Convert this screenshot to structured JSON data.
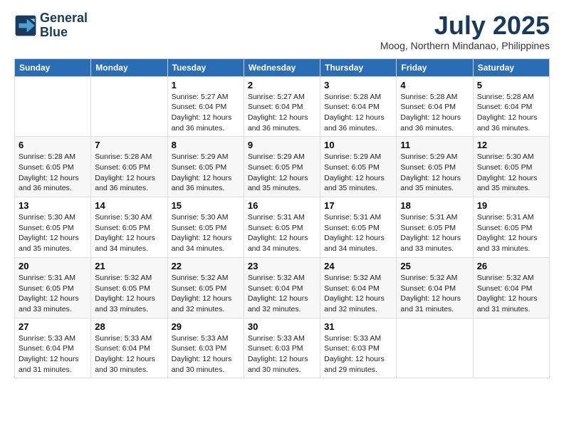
{
  "logo": {
    "line1": "General",
    "line2": "Blue"
  },
  "title": "July 2025",
  "location": "Moog, Northern Mindanao, Philippines",
  "days_of_week": [
    "Sunday",
    "Monday",
    "Tuesday",
    "Wednesday",
    "Thursday",
    "Friday",
    "Saturday"
  ],
  "weeks": [
    [
      {
        "day": "",
        "sunrise": "",
        "sunset": "",
        "daylight": ""
      },
      {
        "day": "",
        "sunrise": "",
        "sunset": "",
        "daylight": ""
      },
      {
        "day": "1",
        "sunrise": "Sunrise: 5:27 AM",
        "sunset": "Sunset: 6:04 PM",
        "daylight": "Daylight: 12 hours and 36 minutes."
      },
      {
        "day": "2",
        "sunrise": "Sunrise: 5:27 AM",
        "sunset": "Sunset: 6:04 PM",
        "daylight": "Daylight: 12 hours and 36 minutes."
      },
      {
        "day": "3",
        "sunrise": "Sunrise: 5:28 AM",
        "sunset": "Sunset: 6:04 PM",
        "daylight": "Daylight: 12 hours and 36 minutes."
      },
      {
        "day": "4",
        "sunrise": "Sunrise: 5:28 AM",
        "sunset": "Sunset: 6:04 PM",
        "daylight": "Daylight: 12 hours and 36 minutes."
      },
      {
        "day": "5",
        "sunrise": "Sunrise: 5:28 AM",
        "sunset": "Sunset: 6:04 PM",
        "daylight": "Daylight: 12 hours and 36 minutes."
      }
    ],
    [
      {
        "day": "6",
        "sunrise": "Sunrise: 5:28 AM",
        "sunset": "Sunset: 6:05 PM",
        "daylight": "Daylight: 12 hours and 36 minutes."
      },
      {
        "day": "7",
        "sunrise": "Sunrise: 5:28 AM",
        "sunset": "Sunset: 6:05 PM",
        "daylight": "Daylight: 12 hours and 36 minutes."
      },
      {
        "day": "8",
        "sunrise": "Sunrise: 5:29 AM",
        "sunset": "Sunset: 6:05 PM",
        "daylight": "Daylight: 12 hours and 36 minutes."
      },
      {
        "day": "9",
        "sunrise": "Sunrise: 5:29 AM",
        "sunset": "Sunset: 6:05 PM",
        "daylight": "Daylight: 12 hours and 35 minutes."
      },
      {
        "day": "10",
        "sunrise": "Sunrise: 5:29 AM",
        "sunset": "Sunset: 6:05 PM",
        "daylight": "Daylight: 12 hours and 35 minutes."
      },
      {
        "day": "11",
        "sunrise": "Sunrise: 5:29 AM",
        "sunset": "Sunset: 6:05 PM",
        "daylight": "Daylight: 12 hours and 35 minutes."
      },
      {
        "day": "12",
        "sunrise": "Sunrise: 5:30 AM",
        "sunset": "Sunset: 6:05 PM",
        "daylight": "Daylight: 12 hours and 35 minutes."
      }
    ],
    [
      {
        "day": "13",
        "sunrise": "Sunrise: 5:30 AM",
        "sunset": "Sunset: 6:05 PM",
        "daylight": "Daylight: 12 hours and 35 minutes."
      },
      {
        "day": "14",
        "sunrise": "Sunrise: 5:30 AM",
        "sunset": "Sunset: 6:05 PM",
        "daylight": "Daylight: 12 hours and 34 minutes."
      },
      {
        "day": "15",
        "sunrise": "Sunrise: 5:30 AM",
        "sunset": "Sunset: 6:05 PM",
        "daylight": "Daylight: 12 hours and 34 minutes."
      },
      {
        "day": "16",
        "sunrise": "Sunrise: 5:31 AM",
        "sunset": "Sunset: 6:05 PM",
        "daylight": "Daylight: 12 hours and 34 minutes."
      },
      {
        "day": "17",
        "sunrise": "Sunrise: 5:31 AM",
        "sunset": "Sunset: 6:05 PM",
        "daylight": "Daylight: 12 hours and 34 minutes."
      },
      {
        "day": "18",
        "sunrise": "Sunrise: 5:31 AM",
        "sunset": "Sunset: 6:05 PM",
        "daylight": "Daylight: 12 hours and 33 minutes."
      },
      {
        "day": "19",
        "sunrise": "Sunrise: 5:31 AM",
        "sunset": "Sunset: 6:05 PM",
        "daylight": "Daylight: 12 hours and 33 minutes."
      }
    ],
    [
      {
        "day": "20",
        "sunrise": "Sunrise: 5:31 AM",
        "sunset": "Sunset: 6:05 PM",
        "daylight": "Daylight: 12 hours and 33 minutes."
      },
      {
        "day": "21",
        "sunrise": "Sunrise: 5:32 AM",
        "sunset": "Sunset: 6:05 PM",
        "daylight": "Daylight: 12 hours and 33 minutes."
      },
      {
        "day": "22",
        "sunrise": "Sunrise: 5:32 AM",
        "sunset": "Sunset: 6:05 PM",
        "daylight": "Daylight: 12 hours and 32 minutes."
      },
      {
        "day": "23",
        "sunrise": "Sunrise: 5:32 AM",
        "sunset": "Sunset: 6:04 PM",
        "daylight": "Daylight: 12 hours and 32 minutes."
      },
      {
        "day": "24",
        "sunrise": "Sunrise: 5:32 AM",
        "sunset": "Sunset: 6:04 PM",
        "daylight": "Daylight: 12 hours and 32 minutes."
      },
      {
        "day": "25",
        "sunrise": "Sunrise: 5:32 AM",
        "sunset": "Sunset: 6:04 PM",
        "daylight": "Daylight: 12 hours and 31 minutes."
      },
      {
        "day": "26",
        "sunrise": "Sunrise: 5:32 AM",
        "sunset": "Sunset: 6:04 PM",
        "daylight": "Daylight: 12 hours and 31 minutes."
      }
    ],
    [
      {
        "day": "27",
        "sunrise": "Sunrise: 5:33 AM",
        "sunset": "Sunset: 6:04 PM",
        "daylight": "Daylight: 12 hours and 31 minutes."
      },
      {
        "day": "28",
        "sunrise": "Sunrise: 5:33 AM",
        "sunset": "Sunset: 6:04 PM",
        "daylight": "Daylight: 12 hours and 30 minutes."
      },
      {
        "day": "29",
        "sunrise": "Sunrise: 5:33 AM",
        "sunset": "Sunset: 6:03 PM",
        "daylight": "Daylight: 12 hours and 30 minutes."
      },
      {
        "day": "30",
        "sunrise": "Sunrise: 5:33 AM",
        "sunset": "Sunset: 6:03 PM",
        "daylight": "Daylight: 12 hours and 30 minutes."
      },
      {
        "day": "31",
        "sunrise": "Sunrise: 5:33 AM",
        "sunset": "Sunset: 6:03 PM",
        "daylight": "Daylight: 12 hours and 29 minutes."
      },
      {
        "day": "",
        "sunrise": "",
        "sunset": "",
        "daylight": ""
      },
      {
        "day": "",
        "sunrise": "",
        "sunset": "",
        "daylight": ""
      }
    ]
  ]
}
